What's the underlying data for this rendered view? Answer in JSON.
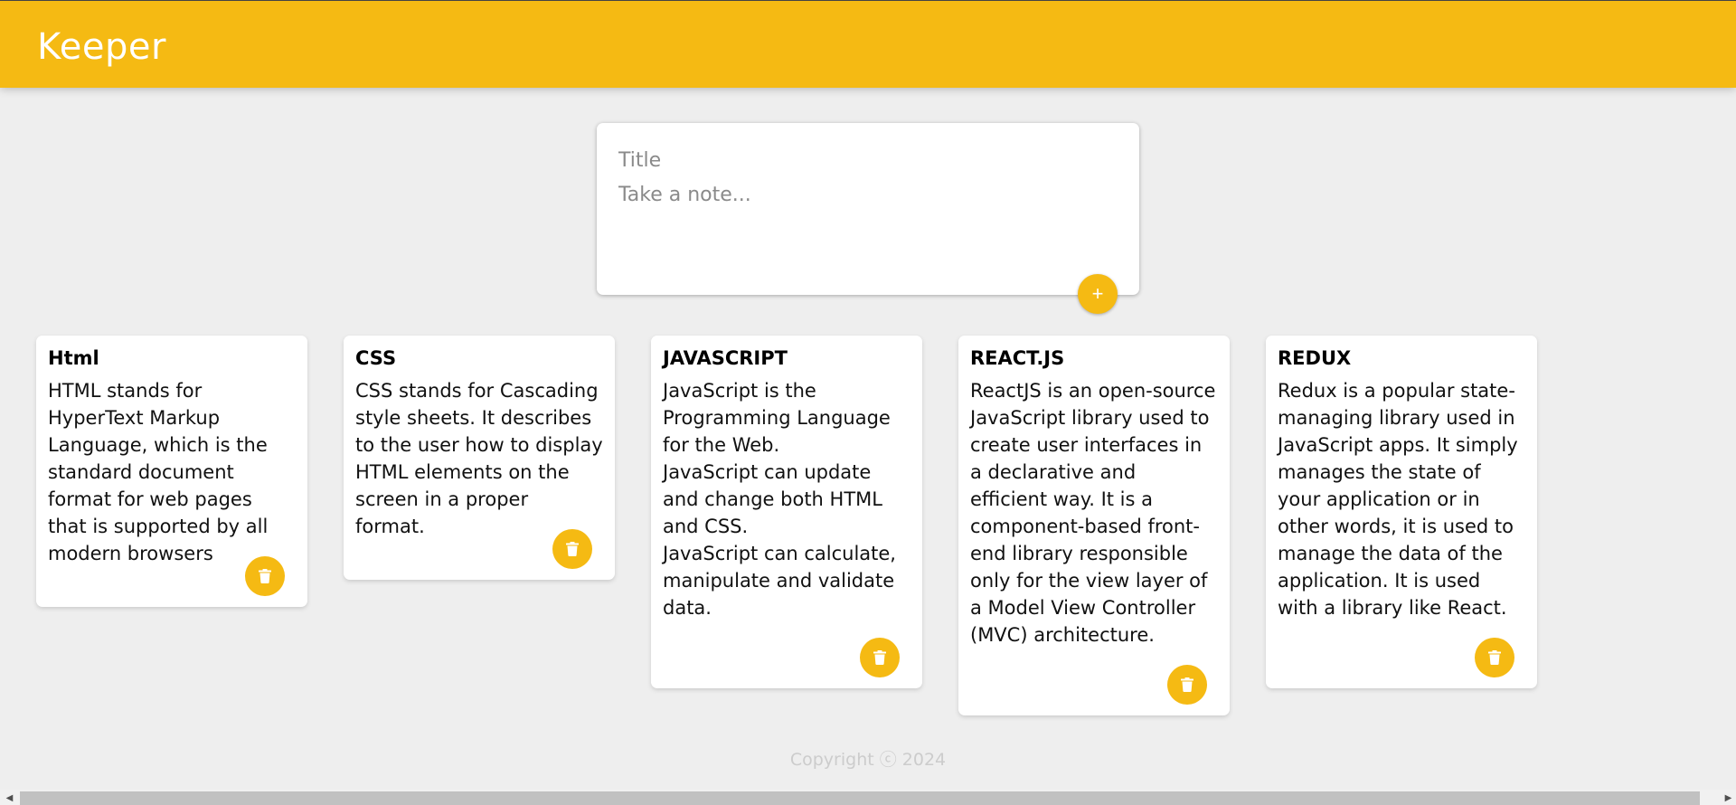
{
  "app": {
    "title": "Keeper",
    "accent": "#f5ba13"
  },
  "create": {
    "title_placeholder": "Title",
    "content_placeholder": "Take a note...",
    "add_label": "+"
  },
  "notes": [
    {
      "title": "Html",
      "content": "HTML stands for HyperText Markup Language, which is the standard document format for web pages that is supported by all modern browsers"
    },
    {
      "title": "CSS",
      "content": "CSS stands for Cascading style sheets. It describes to the user how to display HTML elements on the screen in a proper format."
    },
    {
      "title": "JAVASCRIPT",
      "content": "JavaScript is the Programming Language for the Web.\nJavaScript can update and change both HTML and CSS.\nJavaScript can calculate, manipulate and validate data."
    },
    {
      "title": "REACT.JS",
      "content": "ReactJS is an open-source JavaScript library used to create user interfaces in a declarative and efficient way. It is a component-based front-end library responsible only for the view layer of a Model View Controller (MVC) architecture."
    },
    {
      "title": "REDUX",
      "content": "Redux is a popular state-managing library used in JavaScript apps. It simply manages the state of your application or in other words, it is used to manage the data of the application. It is used with a library like React."
    }
  ],
  "footer": {
    "text": "Copyright ⓒ 2024"
  },
  "icons": {
    "add": "plus-icon",
    "delete": "trash-icon"
  }
}
